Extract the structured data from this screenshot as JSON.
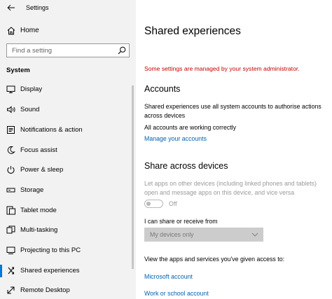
{
  "window": {
    "title": "Settings"
  },
  "sidebar": {
    "home_label": "Home",
    "search_placeholder": "Find a setting",
    "section_label": "System",
    "items": [
      {
        "label": "Display",
        "icon": "display-icon"
      },
      {
        "label": "Sound",
        "icon": "speaker-icon"
      },
      {
        "label": "Notifications & action",
        "icon": "notification-icon"
      },
      {
        "label": "Focus assist",
        "icon": "moon-icon"
      },
      {
        "label": "Power & sleep",
        "icon": "power-icon"
      },
      {
        "label": "Storage",
        "icon": "storage-icon"
      },
      {
        "label": "Tablet mode",
        "icon": "tablet-icon"
      },
      {
        "label": "Multi-tasking",
        "icon": "multitasking-icon"
      },
      {
        "label": "Projecting to this PC",
        "icon": "projecting-icon"
      },
      {
        "label": "Shared experiences",
        "icon": "shared-experiences-icon",
        "selected": true
      },
      {
        "label": "Remote Desktop",
        "icon": "remote-desktop-icon"
      }
    ]
  },
  "main": {
    "title": "Shared experiences",
    "admin_warning": "Some settings are managed by your system administrator.",
    "accounts": {
      "heading": "Accounts",
      "description": "Shared experiences use all system accounts to authorise actions across devices",
      "status": "All accounts are working correctly",
      "manage_link": "Manage your accounts"
    },
    "share": {
      "heading": "Share across devices",
      "description": "Let apps on other devices (including linked phones and tablets) open and message apps on this device, and vice versa",
      "toggle_state": "Off",
      "dropdown_label": "I can share or receive from",
      "dropdown_value": "My devices only",
      "access_text": "View the apps and services you've given access to:",
      "links": [
        "Microsoft account",
        "Work or school account"
      ]
    }
  },
  "colors": {
    "accent": "#0078d7",
    "link": "#0063b1",
    "warning": "#c50000",
    "disabled": "#9a9a9a"
  }
}
